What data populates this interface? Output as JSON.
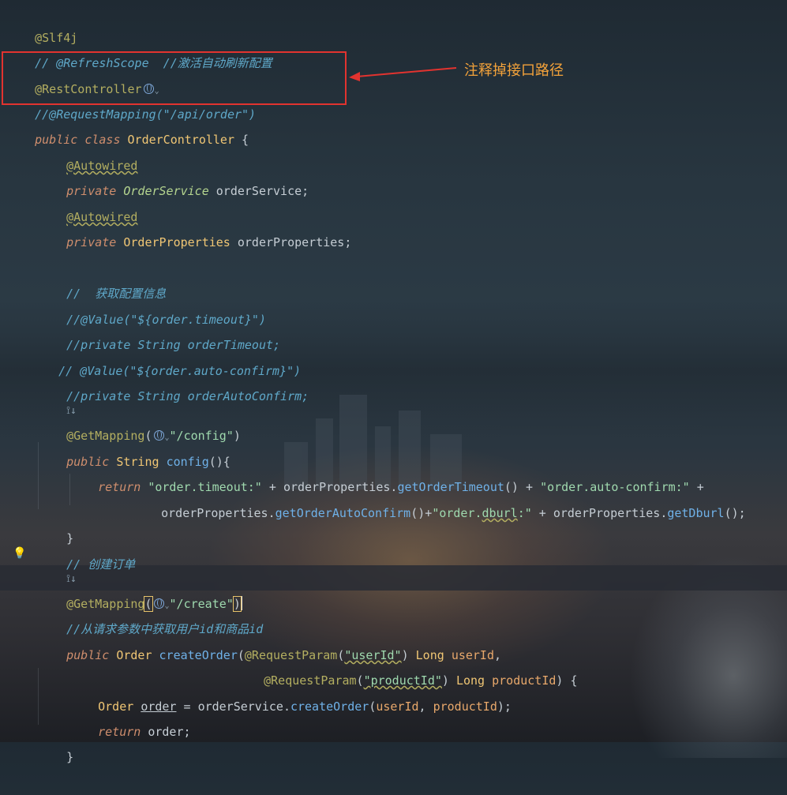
{
  "editor": {
    "lines": {
      "l1": {
        "ann": "@Slf4j"
      },
      "l2": {
        "comment": "// @RefreshScope  //激活自动刷新配置"
      },
      "l3": {
        "ann": "@RestController"
      },
      "l4": {
        "comment": "//@RequestMapping(\"/api/order\")"
      },
      "l5": {
        "kw1": "public",
        "kw2": "class",
        "cls": "OrderController",
        "rest": " {"
      },
      "l6": {
        "ann": "@Autowired"
      },
      "l7": {
        "kw": "private",
        "type": "OrderService",
        "name": "orderService",
        "end": ";"
      },
      "l8": {
        "ann": "@Autowired"
      },
      "l9": {
        "kw": "private",
        "type": "OrderProperties",
        "name": "orderProperties",
        "end": ";"
      },
      "l11": {
        "comment": "//  获取配置信息"
      },
      "l12": {
        "comment": "//@Value(\"${order.timeout}\")"
      },
      "l13": {
        "comment": "//private String orderTimeout;"
      },
      "l14": {
        "comment": "// @Value(\"${order.auto-confirm}\")"
      },
      "l15": {
        "comment": "//private String orderAutoConfirm;"
      },
      "l17": {
        "ann": "@GetMapping",
        "open": "(",
        "str": "\"/config\"",
        "close": ")"
      },
      "l18": {
        "kw": "public",
        "type": "String",
        "method": "config",
        "rest": "(){"
      },
      "l19": {
        "kw": "return",
        "s1": "\"order.timeout:\"",
        "op1": " + ",
        "obj": "orderProperties",
        "dot": ".",
        "m1": "getOrderTimeout",
        "p1": "()",
        "op2": " + ",
        "s2": "\"order.auto-confirm:\"",
        "op3": " +"
      },
      "l20": {
        "obj": "orderProperties",
        "dot": ".",
        "m1": "getOrderAutoConfirm",
        "p1": "()+",
        "s1a": "\"order.",
        "s1b": "dburl",
        "s1c": ":\"",
        "op": " + ",
        "obj2": "orderProperties",
        "dot2": ".",
        "m2": "getDburl",
        "end": "();"
      },
      "l21": {
        "text": "}"
      },
      "l22": {
        "comment": "// 创建订单"
      },
      "l24": {
        "ann": "@GetMapping",
        "open": "(",
        "str": "\"/create\"",
        "close": ")"
      },
      "l25": {
        "comment": "//从请求参数中获取用户id和商品id"
      },
      "l26": {
        "kw": "public",
        "type": "Order",
        "method": "createOrder",
        "open": "(",
        "ann": "@RequestParam",
        "po": "(",
        "str": "\"userId\"",
        "pc": ")",
        "ptype": " Long ",
        "pname": "userId",
        "end": ","
      },
      "l27": {
        "ann": "@RequestParam",
        "po": "(",
        "str": "\"productId\"",
        "pc": ")",
        "ptype": " Long ",
        "pname": "productId",
        "end": ") {"
      },
      "l28": {
        "type": "Order",
        "var": "order",
        "eq": " = ",
        "obj": "orderService",
        "dot": ".",
        "method": "createOrder",
        "open": "(",
        "a1": "userId",
        "comma": ", ",
        "a2": "productId",
        "end": ");"
      },
      "l29": {
        "kw": "return",
        "rest": " order;"
      },
      "l30": {
        "text": "}"
      }
    }
  },
  "annotation": {
    "callout_text": "注释掉接口路径",
    "box_color": "#e2332f",
    "text_color": "#f3a23a"
  },
  "icons": {
    "globe": "globe-icon",
    "bulb": "lightbulb-icon",
    "gutter": "run-gutter-icon"
  }
}
